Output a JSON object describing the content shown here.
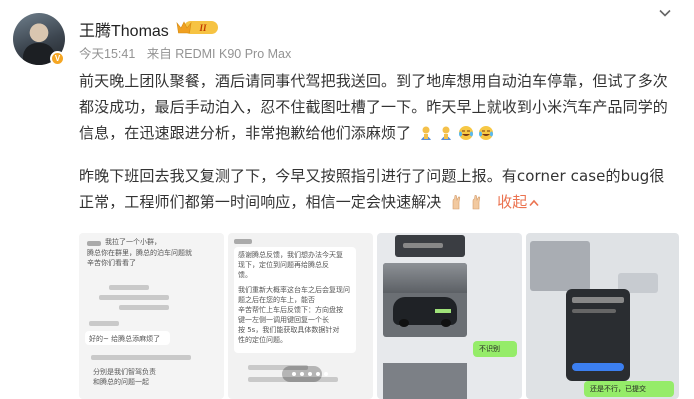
{
  "post": {
    "author": {
      "name": "王腾Thomas",
      "avatar_badge": "V",
      "vip_badge": "II"
    },
    "meta": {
      "time": "今天15:41",
      "source": "来自 REDMI K90 Pro Max"
    },
    "paragraphs": [
      "前天晚上团队聚餐，酒后请同事代驾把我送回。到了地库想用自动泊车停靠，但试了多次都没成功，最后手动泊入，忍不住截图吐槽了一下。昨天早上就收到小米汽车产品同学的信息，在迅速跟进分析，非常抱歉给他们添麻烦了",
      "昨晚下班回去我又复测了下，今早又按照指引进行了问题上报。有corner case的bug很正常，工程师们都第一时间响应，相信一定会快速解决"
    ],
    "emojis_p1": [
      "bow-icon",
      "bow-icon",
      "laugh-cry-icon",
      "laugh-cry-icon"
    ],
    "emojis_p2": [
      "fingers-crossed-icon",
      "fingers-crossed-icon"
    ],
    "collapse_label": "收起",
    "accent_color": "#eb7350"
  },
  "images": {
    "thumb1": {
      "lines": [
        "我拉了一个小群，",
        "腾总你在群里，腾总的泊车问题就",
        "辛苦你们看看了",
        "好的~ 给腾总添麻烦了",
        "分别是我们智驾负责",
        "和腾总的问题一起"
      ]
    },
    "thumb2": {
      "lines": [
        "感谢腾总反馈，我们想办法今天复",
        "现下，定位到问题再给腾总反",
        "馈。",
        "我们重新大概率这台车之后会复现问",
        "题之后在您的车上，能否",
        "辛苦帮忙上车后反馈下：方向盘按",
        "键一左侧一调用键回复一个长",
        "按 5s，我们能获取具体数据针对",
        "性的定位问题。"
      ]
    },
    "thumb3": {
      "label": "不识别"
    },
    "thumb4": {
      "label": "还是不行，已提交"
    }
  }
}
